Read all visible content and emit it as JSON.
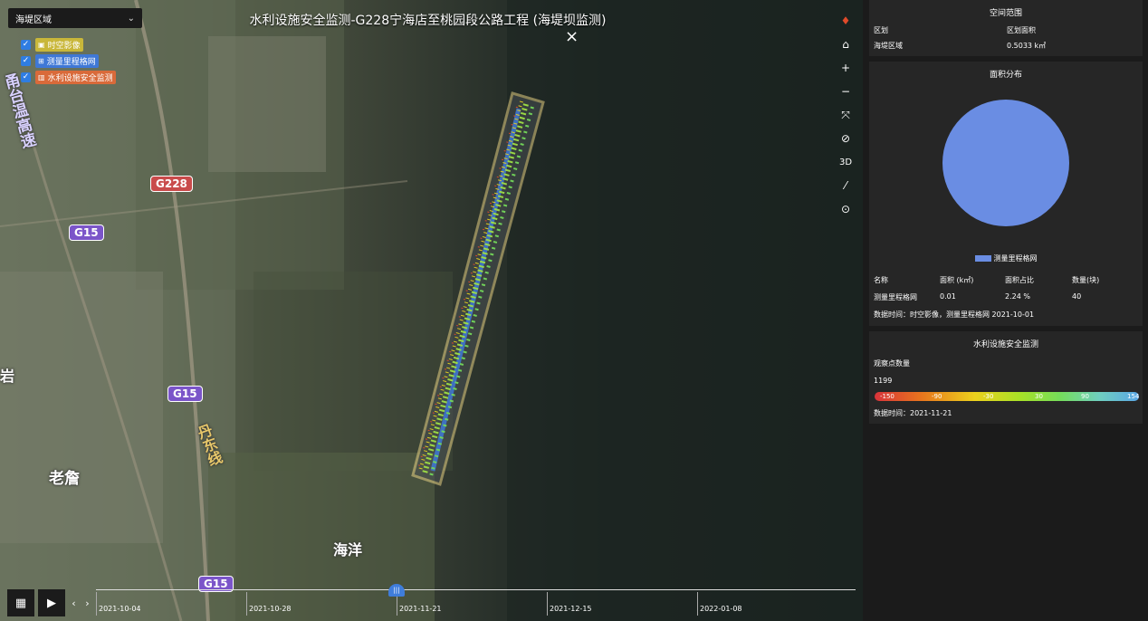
{
  "map": {
    "title": "水利设施安全监测-G228宁海店至桃园段公路工程 (海堤坝监测)",
    "close_label": "×",
    "region_select": {
      "value": "海堤区域"
    },
    "layers": [
      {
        "label": "时空影像",
        "color": "#c9b73a",
        "checked": true
      },
      {
        "label": "测量里程格网",
        "color": "#3f78d6",
        "checked": true
      },
      {
        "label": "水利设施安全监测",
        "color": "#d96a3a",
        "checked": true
      }
    ],
    "road_badges": [
      {
        "label": "G228",
        "color": "#c94b4b"
      },
      {
        "label": "G15",
        "color": "#7b55c9"
      },
      {
        "label": "G15",
        "color": "#7b55c9"
      },
      {
        "label": "G15",
        "color": "#7b55c9"
      }
    ],
    "places": [
      "甬台温高速",
      "丹东线",
      "老詹",
      "海洋",
      "岩"
    ],
    "tools": [
      "compass-icon",
      "home-icon",
      "zoom-in-icon",
      "zoom-out-icon",
      "fullscreen-icon",
      "hide-icon",
      "3D",
      "ruler-icon",
      "locate-icon"
    ],
    "tool_3d_label": "3D"
  },
  "timeline": {
    "dates": [
      "2021-10-04",
      "2021-10-28",
      "2021-11-21",
      "2021-12-15",
      "2022-01-08"
    ],
    "current": "2021-11-21"
  },
  "panel": {
    "spatial": {
      "title": "空间范围",
      "col1_header": "区划",
      "col2_header": "区划面积",
      "region": "海堤区域",
      "area": "0.5033 k㎡"
    },
    "area_dist": {
      "title": "面积分布",
      "legend": "测量里程格网",
      "pie_color": "#6a8de3",
      "headers": [
        "名称",
        "面积 (k㎡)",
        "面积占比",
        "数量(块)"
      ],
      "row": [
        "测量里程格网",
        "0.01",
        "2.24 %",
        "40"
      ],
      "data_time": "数据时间：时空影像，测量里程格网 2021-10-01"
    },
    "monitor": {
      "title": "水利设施安全监测",
      "count_label": "观察点数量",
      "count": "1199",
      "scale": [
        "-150",
        "-90",
        "-30",
        "30",
        "90",
        "154"
      ],
      "data_time": "数据时间：2021-11-21"
    }
  }
}
